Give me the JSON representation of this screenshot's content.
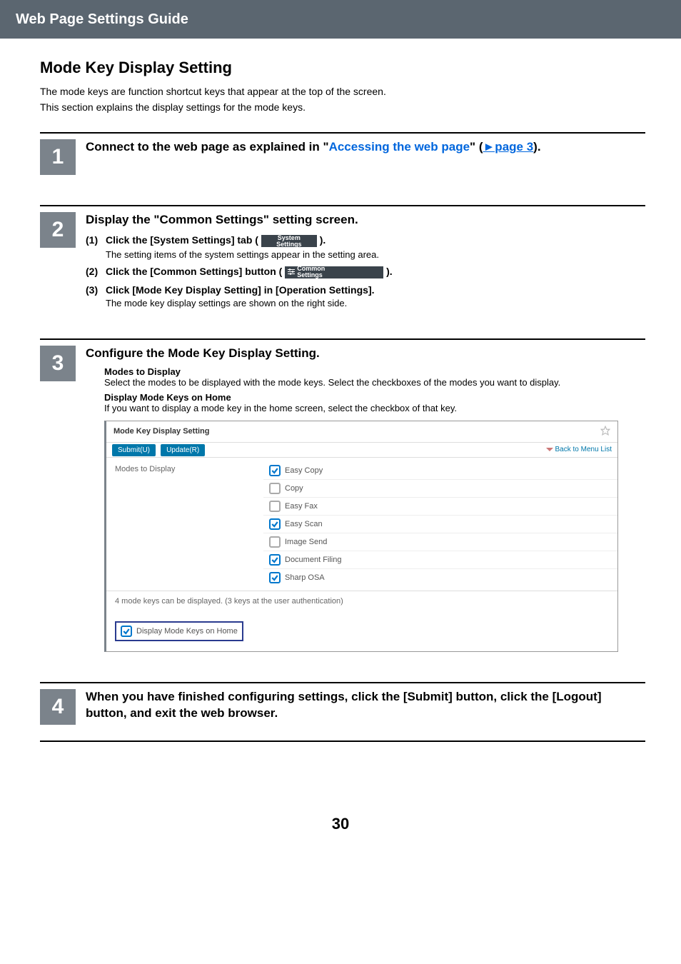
{
  "header": {
    "title": "Web Page Settings Guide"
  },
  "page": {
    "title": "Mode Key Display Setting",
    "intro1": "The mode keys are function shortcut keys that appear at the top of the screen.",
    "intro2": "This section explains the display settings for the mode keys.",
    "number": "30"
  },
  "step1": {
    "num": "1",
    "line_a": "Connect to the web page as explained in \"",
    "link_text": "Accessing the web page",
    "line_b": "\" (",
    "page_link_marker": "►page 3",
    "line_c": ")."
  },
  "step2": {
    "num": "2",
    "heading": "Display the \"Common Settings\" setting screen.",
    "s1_num": "(1)",
    "s1_a": "Click the [System Settings] tab (",
    "s1_chip": "System\nSettings",
    "s1_b": ").",
    "s1_desc": "The setting items of the system settings appear in the setting area.",
    "s2_num": "(2)",
    "s2_a": "Click the [Common Settings] button (",
    "s2_chip": "Common\nSettings",
    "s2_b": ").",
    "s3_num": "(3)",
    "s3_a": "Click [Mode Key Display Setting] in [Operation Settings].",
    "s3_desc": "The mode key display settings are shown on the right side."
  },
  "step3": {
    "num": "3",
    "heading": "Configure the Mode Key Display Setting.",
    "g1_hdr": "Modes to Display",
    "g1_desc": "Select the modes to be displayed with the mode keys. Select the checkboxes of the modes you want to display.",
    "g2_hdr": "Display Mode Keys on Home",
    "g2_desc": "If you want to display a mode key in the home screen, select the checkbox of that key."
  },
  "screenshot": {
    "title": "Mode Key Display Setting",
    "submit": "Submit(U)",
    "update": "Update(R)",
    "back": "Back to Menu List",
    "left_label": "Modes to Display",
    "modes": [
      {
        "label": "Easy Copy",
        "checked": true
      },
      {
        "label": "Copy",
        "checked": false
      },
      {
        "label": "Easy Fax",
        "checked": false
      },
      {
        "label": "Easy Scan",
        "checked": true
      },
      {
        "label": "Image Send",
        "checked": false
      },
      {
        "label": "Document Filing",
        "checked": true
      },
      {
        "label": "Sharp OSA",
        "checked": true
      }
    ],
    "note": "4 mode keys can be displayed. (3 keys at the user authentication)",
    "home_cb": "Display Mode Keys on Home"
  },
  "step4": {
    "num": "4",
    "heading": "When you have finished configuring settings, click the [Submit] button, click the [Logout] button, and exit the web browser."
  }
}
